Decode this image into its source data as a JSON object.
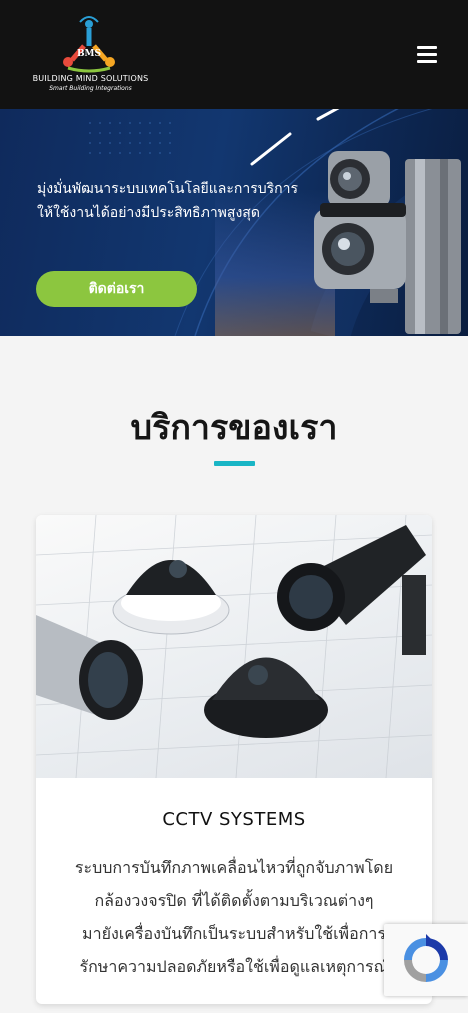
{
  "header": {
    "logo_mark": "BMS",
    "logo_name": "BUILDING MIND SOLUTIONS",
    "logo_tagline": "Smart Building Integrations"
  },
  "hero": {
    "headline_line1": "มุ่งมั่นพัฒนาระบบเทคโนโลยีและการบริการ",
    "headline_line2": "ให้ใช้งานได้อย่างมีประสิทธิภาพสูงสุด",
    "cta_label": "ติดต่อเรา"
  },
  "services": {
    "title": "บริการของเรา",
    "accent_color": "#19b5c5",
    "cards": [
      {
        "title": "CCTV SYSTEMS",
        "desc_lines": [
          "ระบบการบันทึกภาพเคลื่อนไหวที่ถูกจับภาพโดย",
          "กล้องวงจรปิด ที่ได้ติดตั้งตามบริเวณต่างๆ",
          "มายังเครื่องบันทึกเป็นระบบสำหรับใช้เพื่อการ",
          "รักษาความปลอดภัยหรือใช้เพื่อดูแลเหตุการณ์"
        ]
      }
    ]
  },
  "colors": {
    "header_bg": "#121212",
    "cta": "#8cc63f",
    "hero_bg": "#123770"
  }
}
